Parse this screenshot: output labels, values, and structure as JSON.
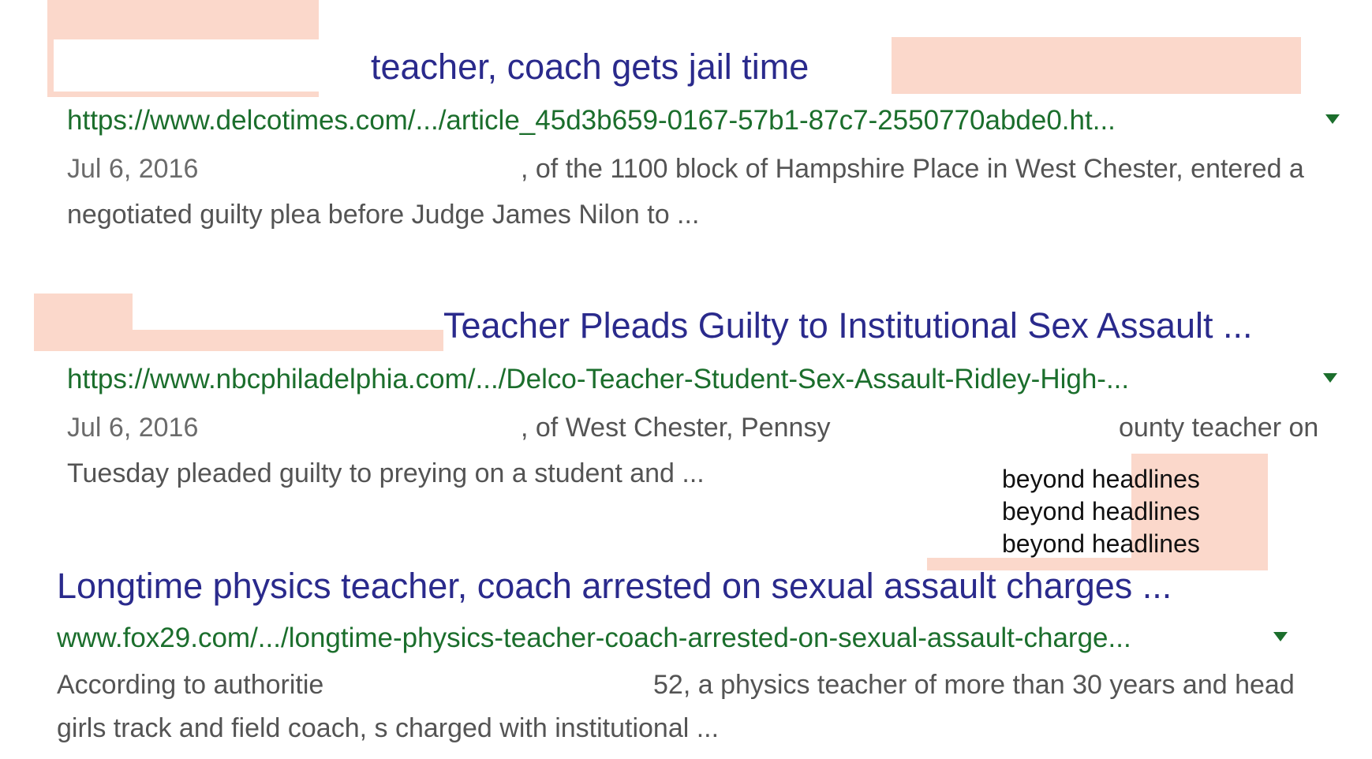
{
  "results": [
    {
      "title": "teacher, coach gets jail time",
      "url": "https://www.delcotimes.com/.../article_45d3b659-0167-57b1-87c7-2550770abde0.ht...",
      "date": "Jul 6, 2016",
      "snippet_line1_after": ", of the 1100 block of Hampshire Place in West Chester, entered a",
      "snippet_line2": "negotiated guilty plea before Judge James Nilon to ..."
    },
    {
      "title": "Teacher Pleads Guilty to Institutional Sex Assault ...",
      "url": "https://www.nbcphiladelphia.com/.../Delco-Teacher-Student-Sex-Assault-Ridley-High-...",
      "date": "Jul 6, 2016",
      "snippet_line1_a": ", of West Chester, Pennsy",
      "snippet_line1_b": "ounty teacher on",
      "snippet_line2": "Tuesday pleaded guilty to preying on a student and ..."
    },
    {
      "title": "Longtime physics teacher, coach arrested on sexual assault charges ...",
      "url": "www.fox29.com/.../longtime-physics-teacher-coach-arrested-on-sexual-assault-charge...",
      "snippet_line1_a": "According to authoritie",
      "snippet_line1_b": "52, a physics teacher of more than 30 years and head",
      "snippet_line2": "girls track and field coach, s charged with institutional ..."
    }
  ],
  "watermark": {
    "lines": [
      "beyond headlines",
      "beyond headlines",
      "beyond headlines"
    ]
  },
  "colors": {
    "title": "#2a2a8c",
    "url": "#1b6e2c",
    "snippet": "#545454",
    "redaction": "#fbd8cb"
  }
}
